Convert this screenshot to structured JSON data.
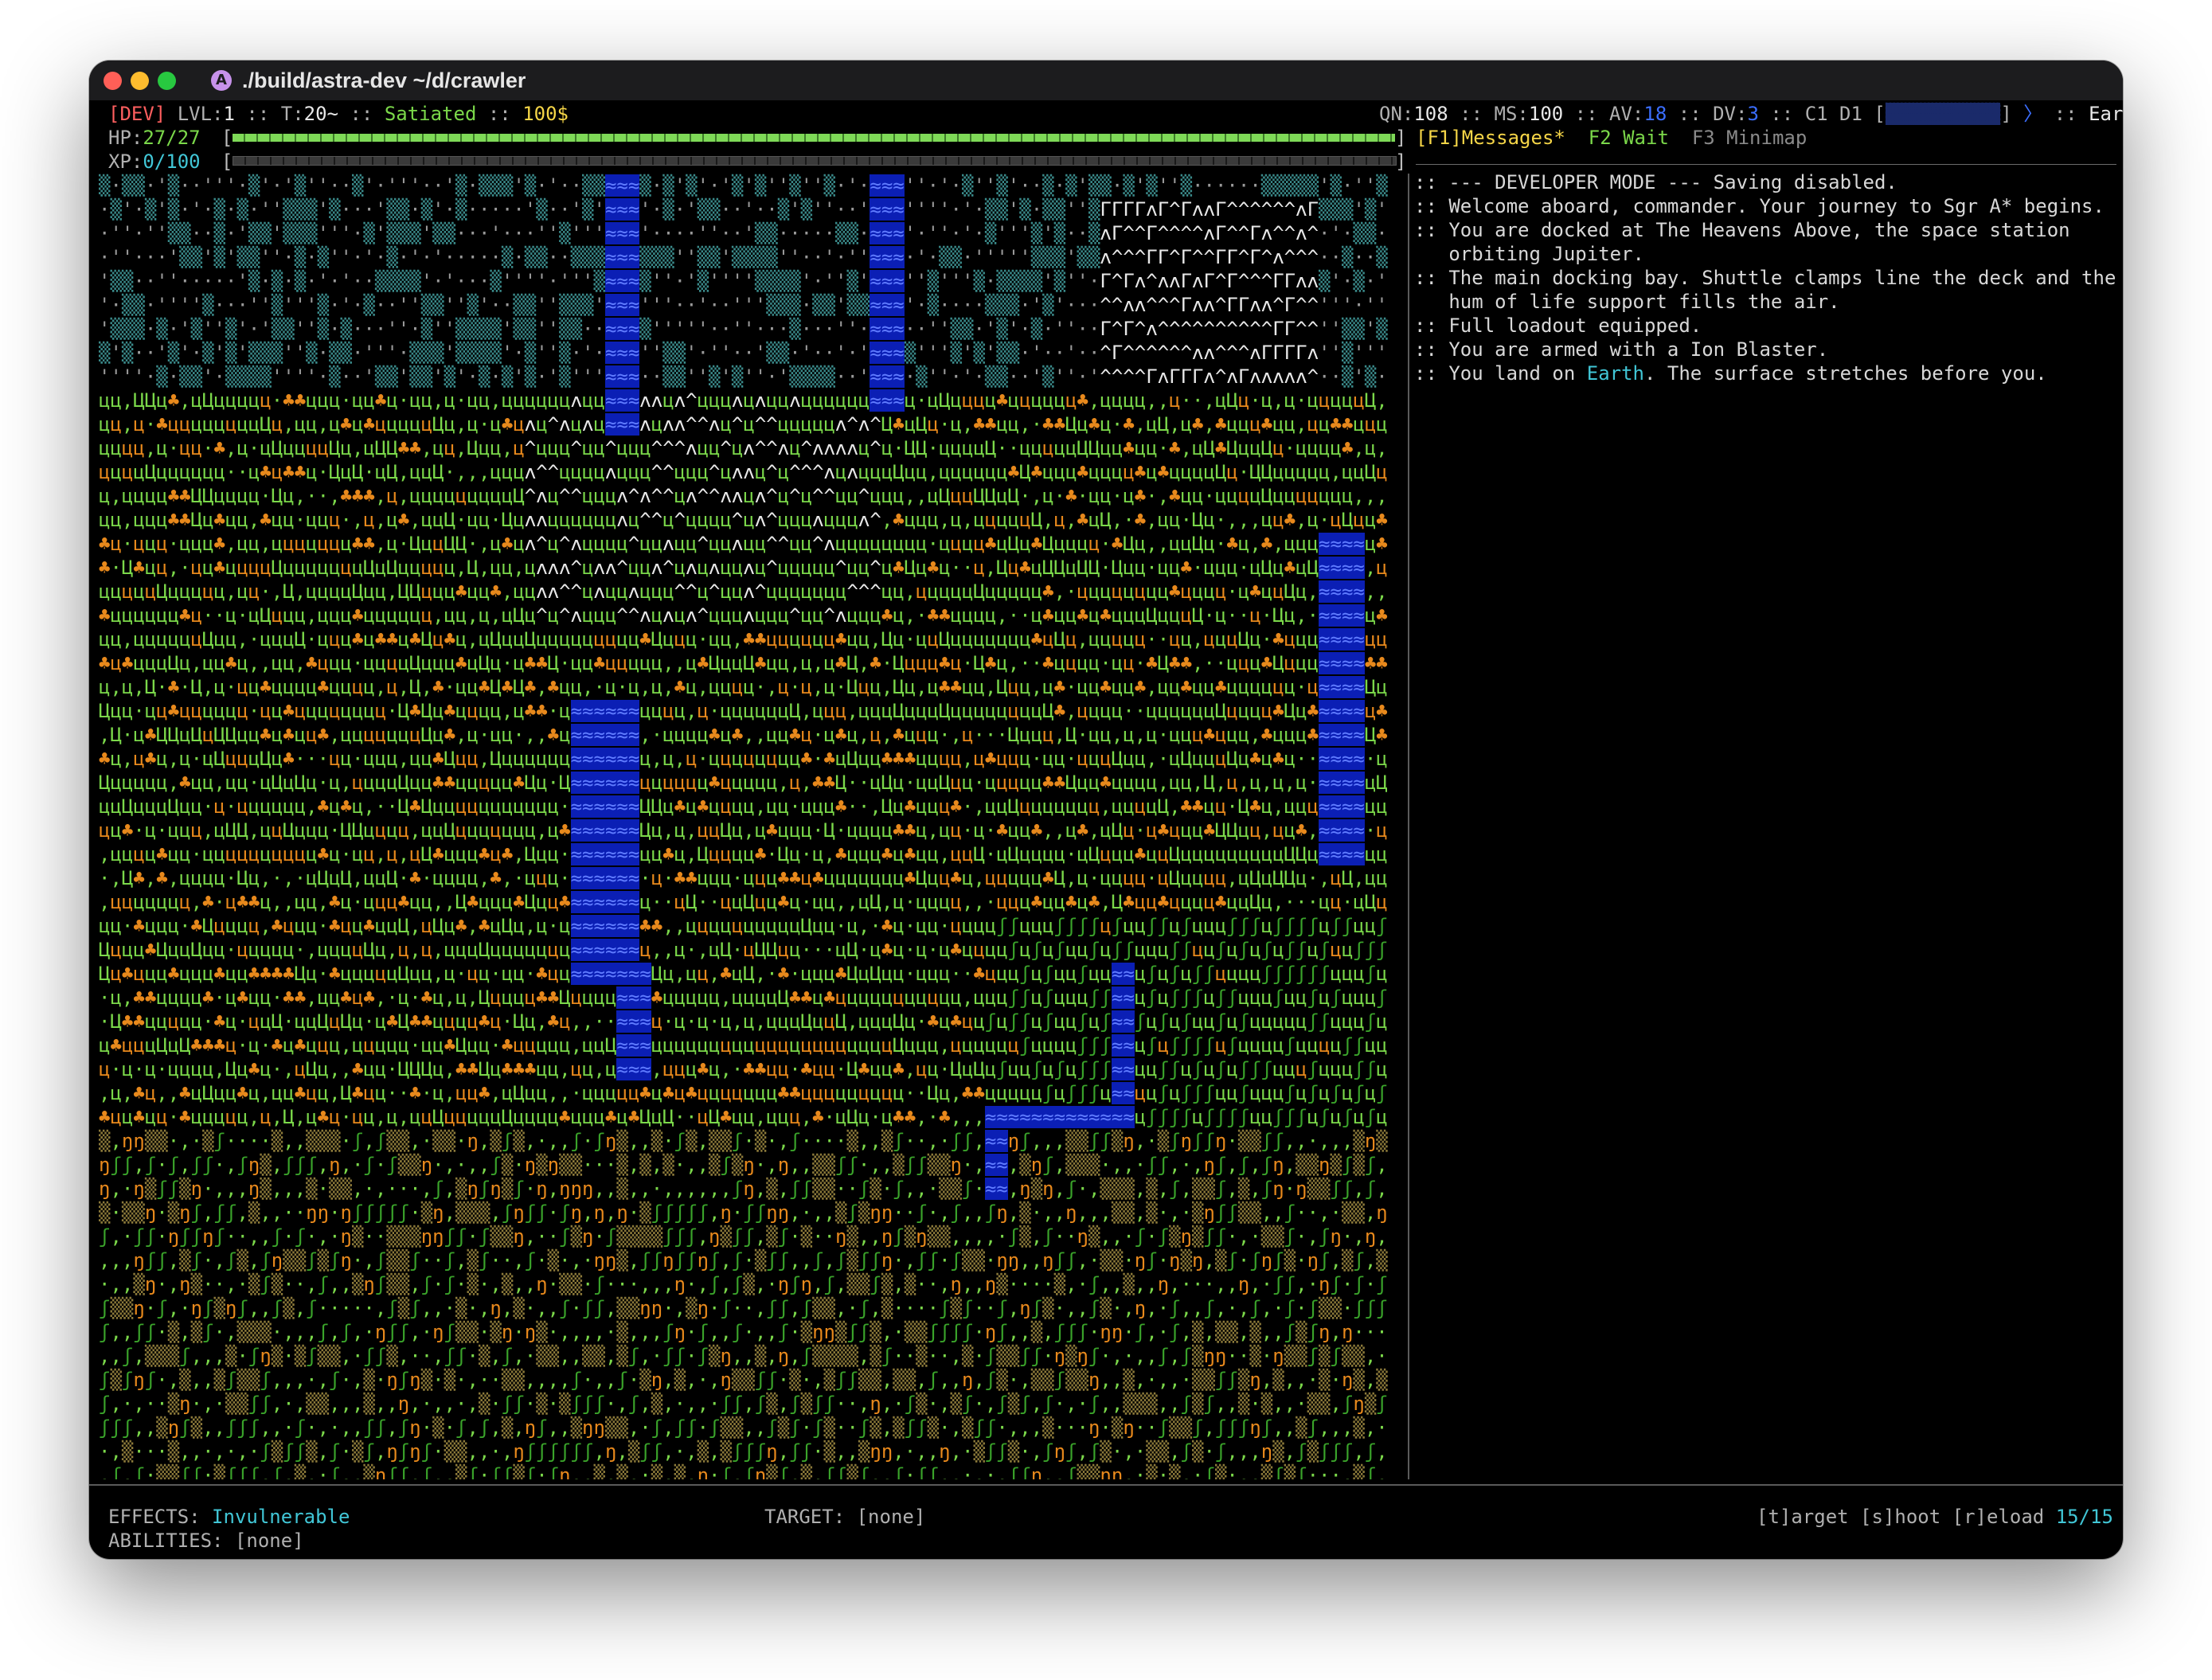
{
  "window": {
    "title": "./build/astra-dev ~/d/crawler",
    "app_icon_letter": "A"
  },
  "status": {
    "dev_tag": "[DEV]",
    "lvl_label": "LVL:",
    "lvl_value": "1",
    "turn_label": "T:",
    "turn_value": "20~",
    "hunger": "Satiated",
    "money": "100$",
    "qn_label": "QN:",
    "qn_value": "108",
    "ms_label": "MS:",
    "ms_value": "100",
    "av_label": "AV:",
    "av_value": "18",
    "dv_label": "DV:",
    "dv_value": "3",
    "cd": "C1 D1",
    "location": "Earth",
    "hp_label": "HP:",
    "hp_value": "27/27",
    "hp_fraction": 1.0,
    "xp_label": "XP:",
    "xp_value": "0/100",
    "xp_fraction": 0.0
  },
  "tabs": {
    "messages": "[F1]Messages*",
    "wait": "F2 Wait",
    "minimap": "F3 Minimap"
  },
  "messages": [
    ":: --- DEVELOPER MODE --- Saving disabled.",
    ":: Welcome aboard, commander. Your journey to Sgr A* begins.",
    ":: You are docked at The Heavens Above, the space station",
    "   orbiting Jupiter.",
    ":: The main docking bay. Shuttle clamps line the deck and the",
    "   hum of life support fills the air.",
    ":: Full loadout equipped.",
    ":: You are armed with a Ion Blaster.",
    ":: You land on Earth. The surface stretches before you."
  ],
  "footer": {
    "effects_label": "EFFECTS:",
    "effects_value": "Invulnerable",
    "abilities_label": "ABILITIES:",
    "abilities_value": "[none]",
    "target_label": "TARGET:",
    "target_value": "[none]",
    "actions": "[t]arget [s]hoot [r]eload",
    "ammo": "15/15"
  },
  "colors": {
    "grass": "#7bd84a",
    "tree": "#e8891c",
    "water": "#0b1fb5",
    "mountain": "#e8e8e8",
    "stone": "#3a8a8a",
    "sand": "#8c7a3a"
  }
}
